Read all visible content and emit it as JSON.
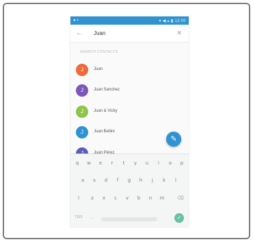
{
  "status_bar": {
    "left": "● ▪",
    "right": "▾ ◀ ▴ ▮ 12:00"
  },
  "toolbar": {
    "back_icon": "←",
    "query": "Juan",
    "clear_icon": "✕"
  },
  "section_label": "SEARCH CONTACTS",
  "contacts": [
    {
      "name": "Juan",
      "initial": "J",
      "color": "#ee6a3a"
    },
    {
      "name": "Juan Sanchez",
      "initial": "J",
      "color": "#7b58b8"
    },
    {
      "name": "Juan & Vicky",
      "initial": "J",
      "color": "#8ec44a"
    },
    {
      "name": "Juan Bellini",
      "initial": "J",
      "color": "#2f93d2"
    },
    {
      "name": "Juan Pérez",
      "initial": "J",
      "color": "#5a5fb8"
    }
  ],
  "fab_icon": "✎",
  "keyboard": {
    "row1": [
      "q",
      "w",
      "e",
      "r",
      "t",
      "y",
      "u",
      "i",
      "o",
      "p"
    ],
    "row2": [
      "a",
      "s",
      "d",
      "f",
      "g",
      "h",
      "j",
      "k",
      "l"
    ],
    "row3": [
      "⇧",
      "z",
      "x",
      "c",
      "v",
      "b",
      "n",
      "m",
      "⌫"
    ],
    "sym_label": "?123",
    "comma": ",",
    "enter_icon": "✓"
  }
}
